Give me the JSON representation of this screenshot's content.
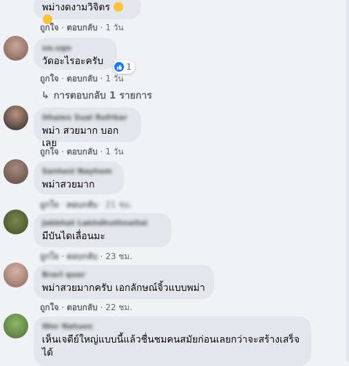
{
  "comments": [
    {
      "text": "พม่างดงามวิจิตร",
      "emoji": "yellow-heart ×2",
      "meta": {
        "like": "ถูกใจ",
        "reply": "ตอบกลับ",
        "time": "1 วัน"
      }
    },
    {
      "name": "ua.ugo",
      "text": "วัดอะไรอะครับ",
      "reaction_count": "1",
      "meta": {
        "like": "ถูกใจ",
        "reply": "ตอบกลับ",
        "time": "1 วัน"
      },
      "replies_label": "การตอบกลับ 1 รายการ"
    },
    {
      "name": "Ithaiex Sual Rofrkar",
      "text": "พม่า สวยมาก บอกเลย",
      "meta": {
        "like": "ถูกใจ",
        "reply": "ตอบกลับ",
        "time": "1 วัน"
      }
    },
    {
      "name": "Santanl Nayhom",
      "text": "พม่าสวยมาก",
      "meta": {
        "like": "ถูกใจ",
        "reply": "ตอบกลับ",
        "time": "21 ชม."
      }
    },
    {
      "name": "Jabbhat Lakhdhuthnaitai",
      "text": "มีบันไดเลื่อนมะ",
      "meta": {
        "like": "ถูกใจ",
        "reply": "ตอบกลับ",
        "time": "23 ชม."
      }
    },
    {
      "name": "Brarl quer",
      "text": "พม่าสวยมากครับ เอกลักษณ์จิ้วแบบพม่า",
      "meta": {
        "like": "ถูกใจ",
        "reply": "ตอบกลับ",
        "time": "22 ชม."
      }
    },
    {
      "name": "Wor Natuen",
      "text": "เห็นเจดีย์ใหญ่แบบนี้แล้วชื่นชมคนสมัยก่อนเลยกว่าจะสร้างเสร็จได้"
    }
  ],
  "colors": {
    "bubble": "#e4e6eb",
    "like": "#1877f2",
    "meta": "#65676b",
    "background": "#f0f2f5"
  }
}
